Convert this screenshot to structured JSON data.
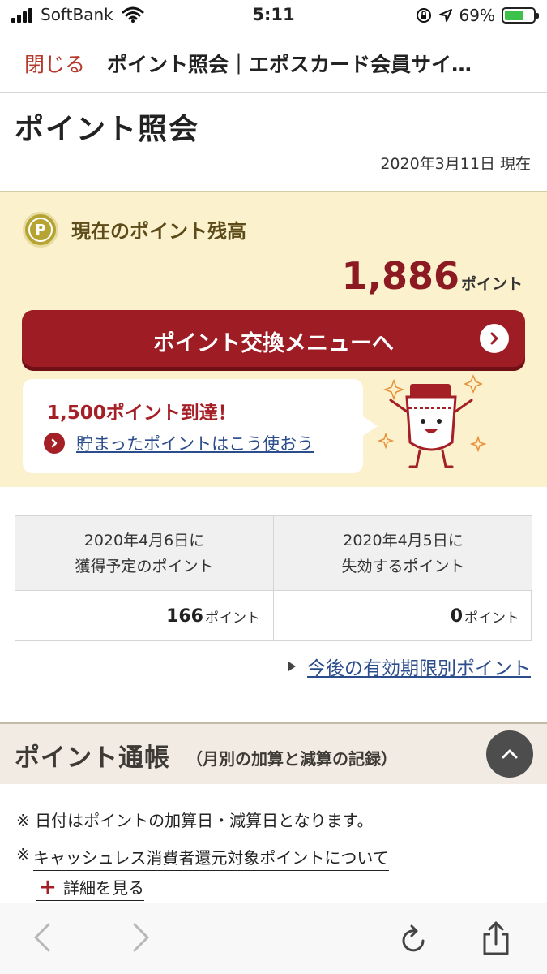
{
  "status_bar": {
    "carrier": "SoftBank",
    "time": "5:11",
    "battery": "69%",
    "battery_level": 0.69
  },
  "nav": {
    "close": "閉じる",
    "title": "ポイント照会｜エポスカード会員サイ…"
  },
  "page": {
    "title": "ポイント照会",
    "as_of": "2020年3月11日 現在"
  },
  "balance": {
    "icon_letter": "P",
    "label": "現在のポイント残高",
    "value": "1,886",
    "unit": "ポイント",
    "exchange_button": "ポイント交換メニューへ",
    "milestone_title": "1,500ポイント到達！",
    "milestone_link": "貯まったポイントはこう使おう"
  },
  "points_table": {
    "columns": [
      {
        "line1": "2020年4月6日に",
        "line2": "獲得予定のポイント",
        "value": "166",
        "unit": "ポイント"
      },
      {
        "line1": "2020年4月5日に",
        "line2": "失効するポイント",
        "value": "0",
        "unit": "ポイント"
      }
    ]
  },
  "expiry_link": "今後の有効期限別ポイント",
  "passbook": {
    "title": "ポイント通帳",
    "subtitle": "（月別の加算と減算の記録）",
    "note1": "※ 日付はポイントの加算日・減算日となります。",
    "note2_mark": "※",
    "note2_link": "キャッシュレス消費者還元対象ポイントについて",
    "details_label": "詳細を見る"
  },
  "colors": {
    "brand_red": "#9e1c24",
    "link_blue": "#2b4d8c",
    "panel_cream": "#fbf1cc",
    "gold": "#b5a332"
  },
  "icons": [
    "signal-icon",
    "wifi-icon",
    "lock-rotation-icon",
    "location-icon",
    "battery-icon",
    "p-point-icon",
    "chevron-right-icon",
    "mascot-illustration",
    "chevron-up-icon",
    "back-icon",
    "forward-icon",
    "reload-icon",
    "share-icon"
  ]
}
